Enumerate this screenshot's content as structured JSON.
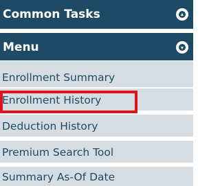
{
  "panel": {
    "common_tasks": {
      "label": "Common Tasks",
      "icon": "collapse-up-icon"
    },
    "menu": {
      "label": "Menu",
      "icon": "expand-down-icon"
    },
    "items": [
      {
        "label": "Enrollment Summary"
      },
      {
        "label": "Enrollment History"
      },
      {
        "label": "Deduction History"
      },
      {
        "label": "Premium Search Tool"
      },
      {
        "label": "Summary As-Of Date"
      }
    ],
    "colors": {
      "header_bg": "#1f4a66",
      "item_bg": "#d5dde3",
      "item_text": "#1f4a66",
      "highlight": "#e0121a"
    }
  }
}
